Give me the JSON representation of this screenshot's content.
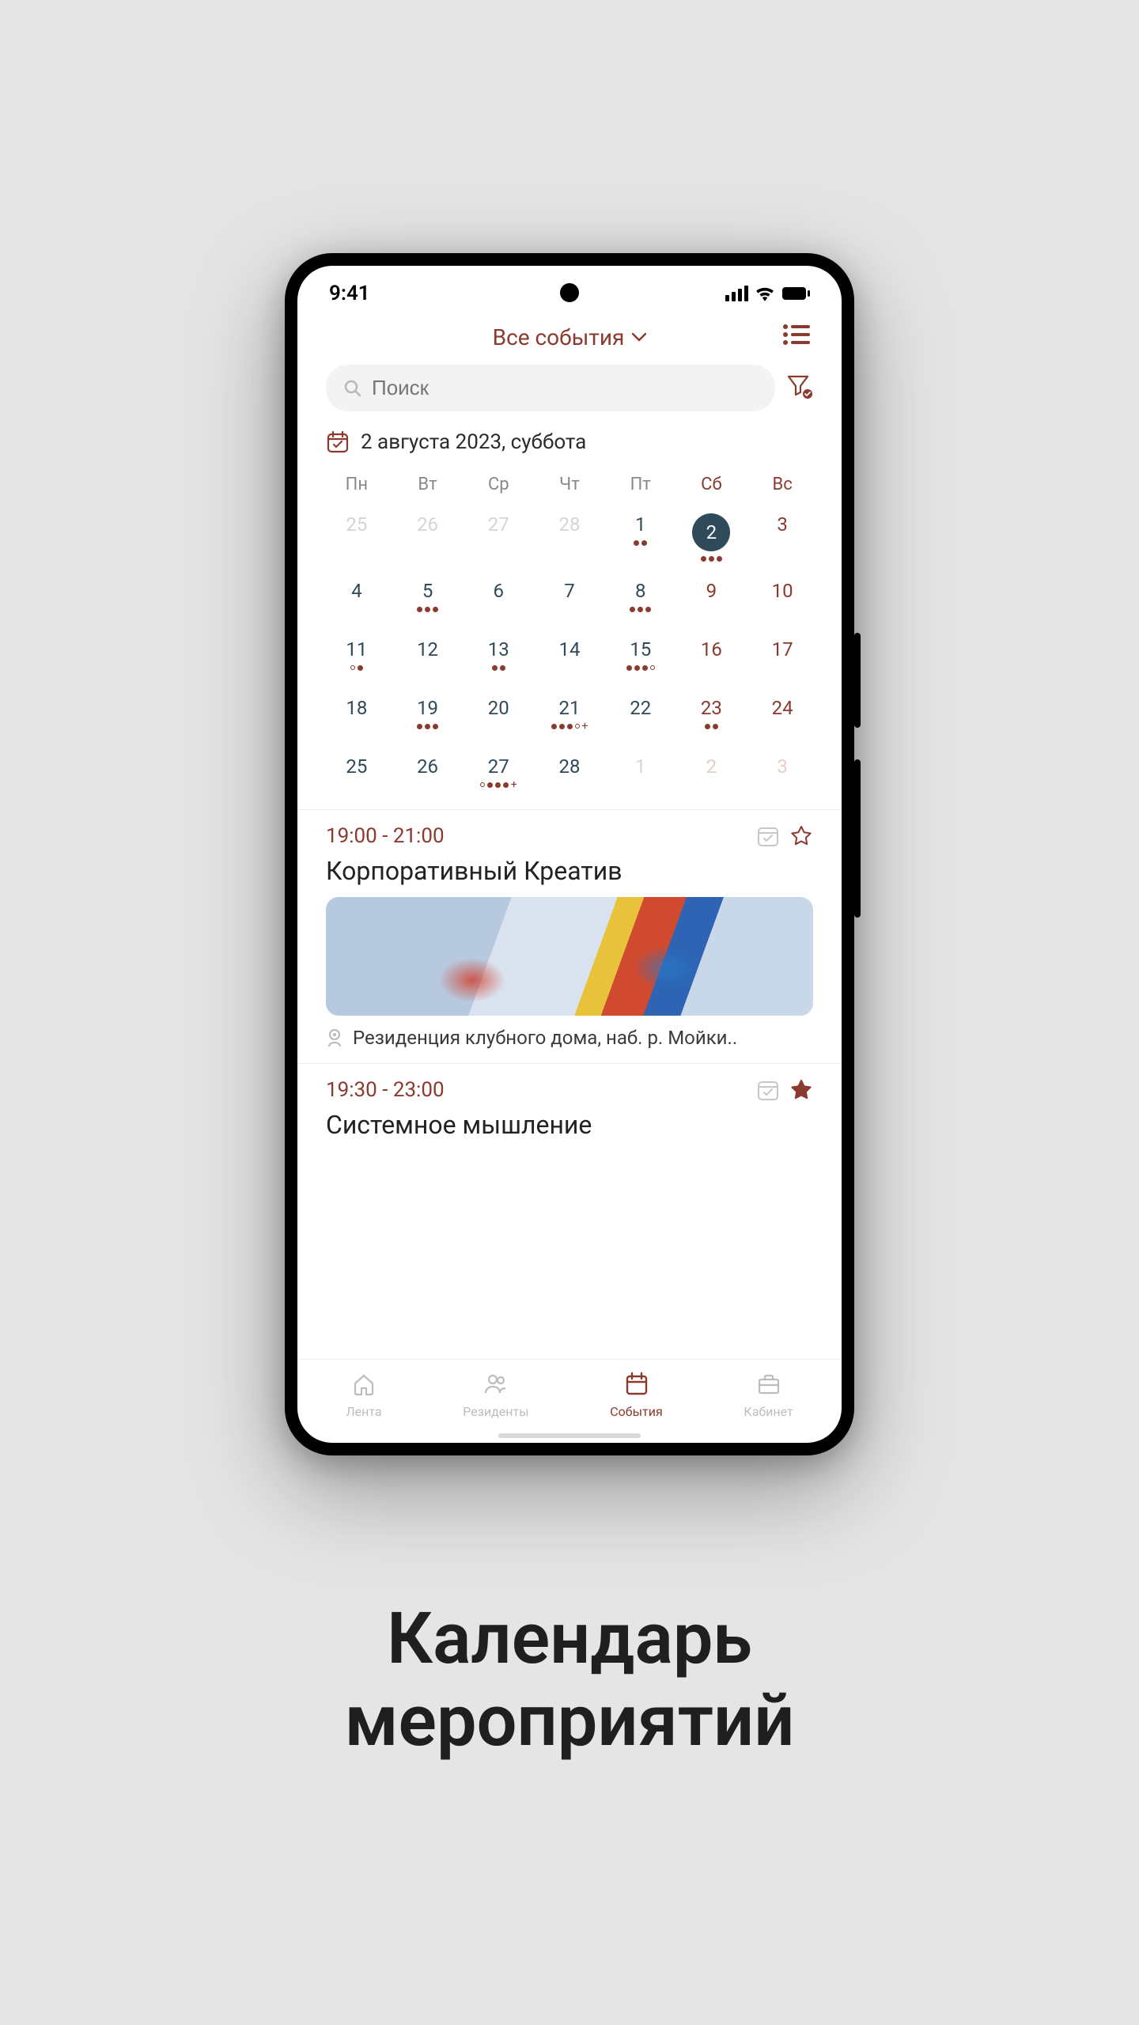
{
  "status": {
    "time": "9:41"
  },
  "header": {
    "dropdown_label": "Все события"
  },
  "search": {
    "placeholder": "Поиск"
  },
  "date": {
    "label": "2 августа 2023, суббота"
  },
  "calendar": {
    "weekdays": [
      "Пн",
      "Вт",
      "Ср",
      "Чт",
      "Пт",
      "Сб",
      "Вс"
    ],
    "weeks": [
      [
        {
          "n": "25",
          "cls": "prev"
        },
        {
          "n": "26",
          "cls": "prev"
        },
        {
          "n": "27",
          "cls": "prev"
        },
        {
          "n": "28",
          "cls": "prev"
        },
        {
          "n": "1",
          "dots": [
            "f",
            "f"
          ]
        },
        {
          "n": "2",
          "cls": "weekend selected",
          "dots": [
            "f",
            "f",
            "f"
          ]
        },
        {
          "n": "3",
          "cls": "weekend"
        }
      ],
      [
        {
          "n": "4"
        },
        {
          "n": "5",
          "dots": [
            "f",
            "f",
            "f"
          ]
        },
        {
          "n": "6"
        },
        {
          "n": "7"
        },
        {
          "n": "8",
          "dots": [
            "f",
            "f",
            "f"
          ]
        },
        {
          "n": "9",
          "cls": "weekend"
        },
        {
          "n": "10",
          "cls": "weekend"
        }
      ],
      [
        {
          "n": "11",
          "dots": [
            "o",
            "f"
          ]
        },
        {
          "n": "12"
        },
        {
          "n": "13",
          "dots": [
            "f",
            "f"
          ]
        },
        {
          "n": "14"
        },
        {
          "n": "15",
          "dots": [
            "f",
            "f",
            "f",
            "o"
          ]
        },
        {
          "n": "16",
          "cls": "weekend"
        },
        {
          "n": "17",
          "cls": "weekend"
        }
      ],
      [
        {
          "n": "18"
        },
        {
          "n": "19",
          "dots": [
            "f",
            "f",
            "f"
          ]
        },
        {
          "n": "20"
        },
        {
          "n": "21",
          "dots": [
            "f",
            "f",
            "f",
            "o",
            "+"
          ]
        },
        {
          "n": "22"
        },
        {
          "n": "23",
          "cls": "weekend",
          "dots": [
            "f",
            "f"
          ]
        },
        {
          "n": "24",
          "cls": "weekend"
        }
      ],
      [
        {
          "n": "25"
        },
        {
          "n": "26"
        },
        {
          "n": "27",
          "dots": [
            "o",
            "f",
            "f",
            "f",
            "+"
          ]
        },
        {
          "n": "28"
        },
        {
          "n": "1",
          "cls": "next"
        },
        {
          "n": "2",
          "cls": "weekend next"
        },
        {
          "n": "3",
          "cls": "weekend next"
        }
      ]
    ]
  },
  "events": [
    {
      "time": "19:00 - 21:00",
      "title": "Корпоративный Креатив",
      "location": "Резиденция клубного дома, наб. р. Мойки..",
      "starred": false,
      "has_image": true
    },
    {
      "time": "19:30 - 23:00",
      "title": "Системное мышление",
      "starred": true,
      "has_image": false
    }
  ],
  "nav": {
    "items": [
      {
        "label": "Лента"
      },
      {
        "label": "Резиденты"
      },
      {
        "label": "События"
      },
      {
        "label": "Кабинет"
      }
    ],
    "active_index": 2
  },
  "caption": {
    "line1": "Календарь",
    "line2": "мероприятий"
  },
  "colors": {
    "accent": "#8a3a2e",
    "dark": "#2f4a5a"
  }
}
